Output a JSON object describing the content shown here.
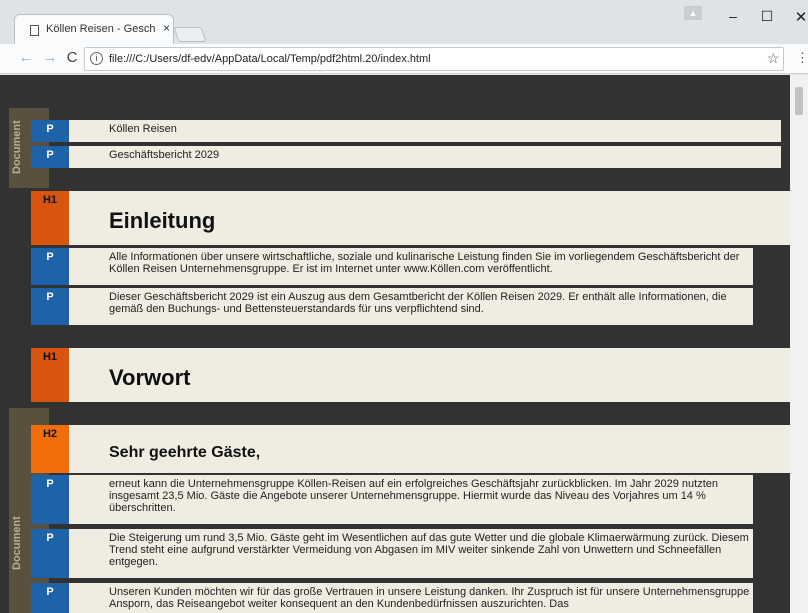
{
  "browser": {
    "tab_title": "Köllen Reisen - Geschäfts",
    "tab_close": "×",
    "url": "file:///C:/Users/df-edv/AppData/Local/Temp/pdf2html.20/index.html",
    "window_buttons": {
      "minimize": "–",
      "maximize": "☐",
      "close": "✕"
    },
    "nav": {
      "back": "←",
      "forward": "→",
      "reload": "C"
    },
    "bookmark_star": "☆",
    "menu": "⋮"
  },
  "document": {
    "side_label": "Document",
    "elements": [
      {
        "tag": "P",
        "type": "p",
        "text": "Köllen Reisen"
      },
      {
        "tag": "P",
        "type": "p",
        "text": "Geschäftsbericht 2029"
      },
      {
        "tag": "H1",
        "type": "h1",
        "text": "Einleitung"
      },
      {
        "tag": "P",
        "type": "p",
        "text": "Alle Informationen über unsere wirtschaftliche, soziale und kulinarische Leistung finden Sie im vorliegendem Geschäftsbericht der Köllen Reisen Unternehmensgruppe. Er ist im Internet unter www.Köllen.com veröffentlicht."
      },
      {
        "tag": "P",
        "type": "p",
        "text": "Dieser Geschäftsbericht 2029 ist ein Auszug aus dem Gesamtbericht der Köllen Reisen 2029. Er enthält alle Informationen, die gemäß den Buchungs- und Bettensteuerstandards für uns verpflichtend sind."
      },
      {
        "tag": "H1",
        "type": "h1",
        "text": "Vorwort"
      },
      {
        "tag": "H2",
        "type": "h2",
        "text": "Sehr geehrte Gäste,"
      },
      {
        "tag": "P",
        "type": "p",
        "text": "erneut kann die Unternehmensgruppe Köllen-Reisen auf ein erfolgreiches Geschäftsjahr zurückblicken. Im Jahr 2029 nutzten insgesamt 23,5 Mio. Gäste die Angebote unserer Unternehmensgruppe. Hiermit wurde das Niveau des Vorjahres um 14 % überschritten."
      },
      {
        "tag": "P",
        "type": "p",
        "text": "Die Steigerung um rund 3,5 Mio. Gäste geht im Wesentlichen auf das gute Wetter und die globale Klimaerwärmung zurück. Diesem Trend steht eine aufgrund verstärkter Vermeidung von Abgasen im MIV weiter sinkende Zahl von Unwettern und Schneefällen entgegen."
      },
      {
        "tag": "P",
        "type": "p",
        "text": "Unseren Kunden möchten wir für das große Vertrauen in unsere Leistung danken. Ihr Zuspruch ist für unsere Unternehmensgruppe Ansporn, das Reiseangebot weiter konsequent an den Kundenbedürfnissen auszurichten. Das"
      }
    ]
  }
}
